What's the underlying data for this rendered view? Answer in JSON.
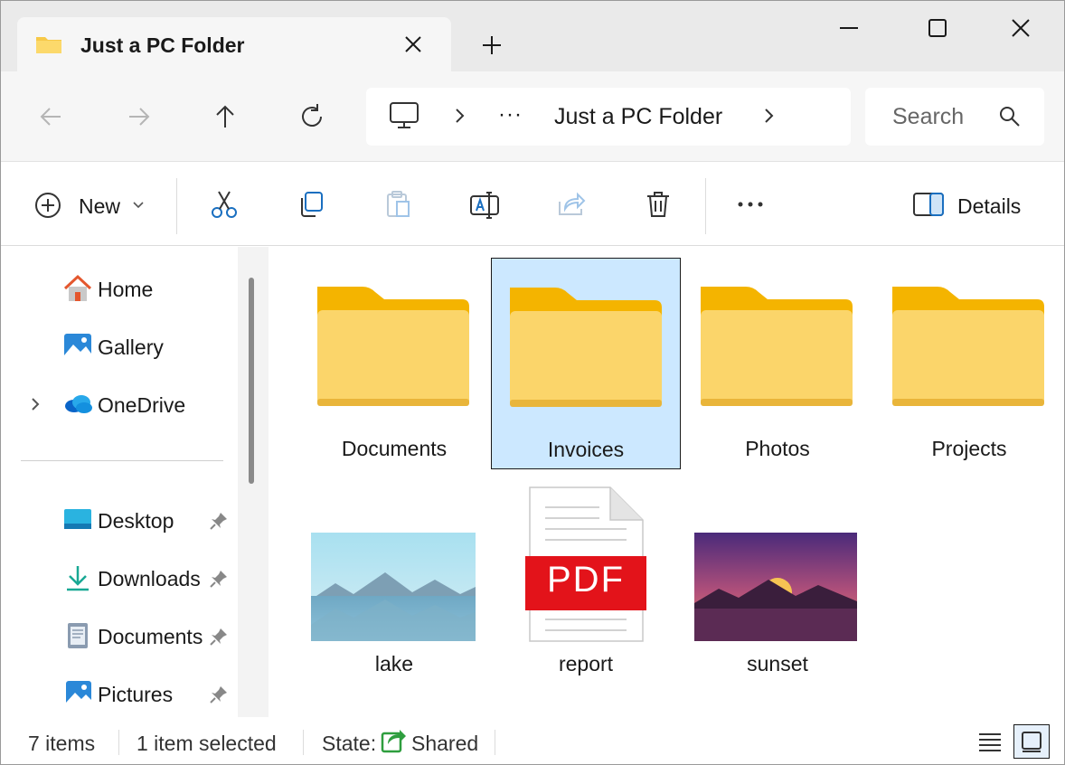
{
  "window": {
    "tab_title": "Just a PC Folder"
  },
  "address": {
    "more": "···",
    "current_folder": "Just a PC Folder",
    "search_placeholder": "Search"
  },
  "commands": {
    "new_label": "New",
    "details_label": "Details",
    "more": "•••"
  },
  "sidebar": {
    "quick": [
      {
        "label": "Home",
        "icon": "home-icon"
      },
      {
        "label": "Gallery",
        "icon": "gallery-icon"
      },
      {
        "label": "OneDrive",
        "icon": "onedrive-icon"
      }
    ],
    "pinned": [
      {
        "label": "Desktop",
        "icon": "desktop-icon"
      },
      {
        "label": "Downloads",
        "icon": "downloads-icon"
      },
      {
        "label": "Documents",
        "icon": "documents-icon"
      },
      {
        "label": "Pictures",
        "icon": "pictures-icon"
      }
    ]
  },
  "items": [
    {
      "name": "Documents",
      "type": "folder"
    },
    {
      "name": "Invoices",
      "type": "folder",
      "selected": true
    },
    {
      "name": "Photos",
      "type": "folder"
    },
    {
      "name": "Projects",
      "type": "folder"
    },
    {
      "name": "lake",
      "type": "image"
    },
    {
      "name": "report",
      "type": "pdf",
      "badge": "PDF"
    },
    {
      "name": "sunset",
      "type": "image"
    }
  ],
  "status": {
    "count": "7 items",
    "selected": "1 item selected",
    "state_label": "State:",
    "state_value": "Shared"
  },
  "colors": {
    "selection": "#cce8ff",
    "folder": "#f7c948",
    "pdf_red": "#e3131a"
  }
}
